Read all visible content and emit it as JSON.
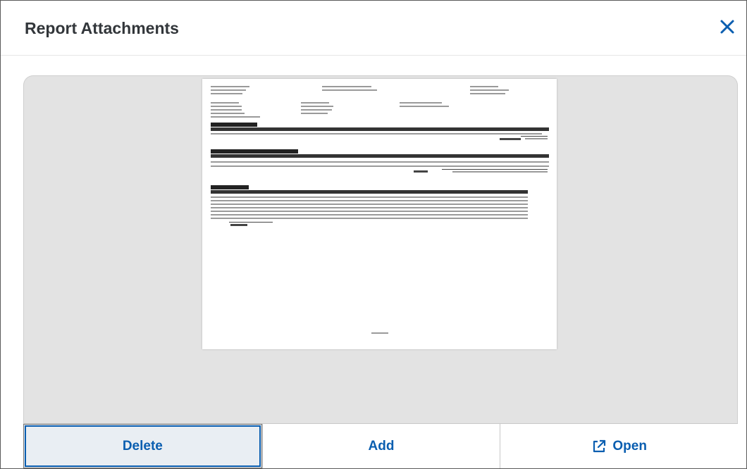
{
  "dialog": {
    "title": "Report Attachments",
    "close_icon": "close-icon",
    "accent_color": "#0a5eb0"
  },
  "viewer": {
    "page_footer_text": "End of Report"
  },
  "footer": {
    "delete_label": "Delete",
    "add_label": "Add",
    "open_label": "Open",
    "open_icon": "external-link-icon"
  }
}
